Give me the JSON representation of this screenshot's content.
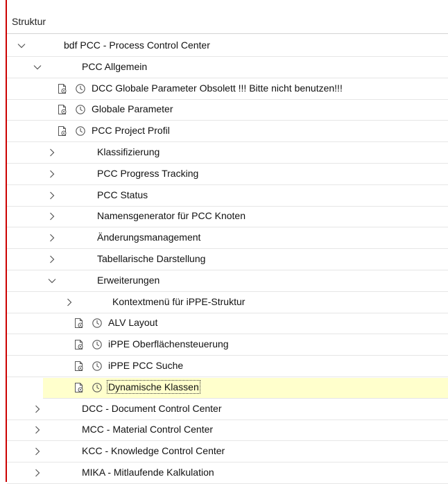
{
  "header": {
    "title": "Struktur"
  },
  "tree": [
    {
      "label": "bdf PCC - Process Control Center",
      "level": 0,
      "state": "expanded",
      "icons": false
    },
    {
      "label": "PCC Allgemein",
      "level": 1,
      "state": "expanded",
      "icons": false
    },
    {
      "label": "DCC Globale Parameter  Obsolett !!! Bitte nicht benutzen!!!",
      "level": 2,
      "state": "leaf",
      "icons": true
    },
    {
      "label": "Globale Parameter",
      "level": 2,
      "state": "leaf",
      "icons": true
    },
    {
      "label": "PCC Project Profil",
      "level": 2,
      "state": "leaf",
      "icons": true
    },
    {
      "label": "Klassifizierung",
      "level": 2,
      "state": "collapsed",
      "icons": false
    },
    {
      "label": "PCC Progress Tracking",
      "level": 2,
      "state": "collapsed",
      "icons": false
    },
    {
      "label": "PCC Status",
      "level": 2,
      "state": "collapsed",
      "icons": false
    },
    {
      "label": "Namensgenerator für PCC Knoten",
      "level": 2,
      "state": "collapsed",
      "icons": false
    },
    {
      "label": "Änderungsmanagement",
      "level": 2,
      "state": "collapsed",
      "icons": false
    },
    {
      "label": "Tabellarische Darstellung",
      "level": 2,
      "state": "collapsed",
      "icons": false
    },
    {
      "label": "Erweiterungen",
      "level": 2,
      "state": "expanded",
      "icons": false
    },
    {
      "label": "Kontextmenü für iPPE-Struktur",
      "level": 3,
      "state": "collapsed",
      "icons": false
    },
    {
      "label": "ALV Layout",
      "level": 3,
      "state": "leaf",
      "icons": true
    },
    {
      "label": "iPPE Oberflächensteuerung",
      "level": 3,
      "state": "leaf",
      "icons": true
    },
    {
      "label": "iPPE PCC Suche",
      "level": 3,
      "state": "leaf",
      "icons": true
    },
    {
      "label": "Dynamische Klassen",
      "level": 3,
      "state": "leaf",
      "icons": true,
      "selected": true
    },
    {
      "label": "DCC - Document Control Center",
      "level": 1,
      "state": "collapsed",
      "icons": false
    },
    {
      "label": "MCC - Material Control Center",
      "level": 1,
      "state": "collapsed",
      "icons": false
    },
    {
      "label": "KCC - Knowledge Control Center",
      "level": 1,
      "state": "collapsed",
      "icons": false
    },
    {
      "label": "MIKA - Mitlaufende Kalkulation",
      "level": 1,
      "state": "collapsed",
      "icons": false
    }
  ],
  "icons": {
    "node_icon": "document-settings-icon",
    "clock_icon": "clock-icon"
  },
  "colors": {
    "selected_bg": "#ffffcc",
    "border_accent": "#cc0000",
    "icon_stroke": "#555555"
  }
}
